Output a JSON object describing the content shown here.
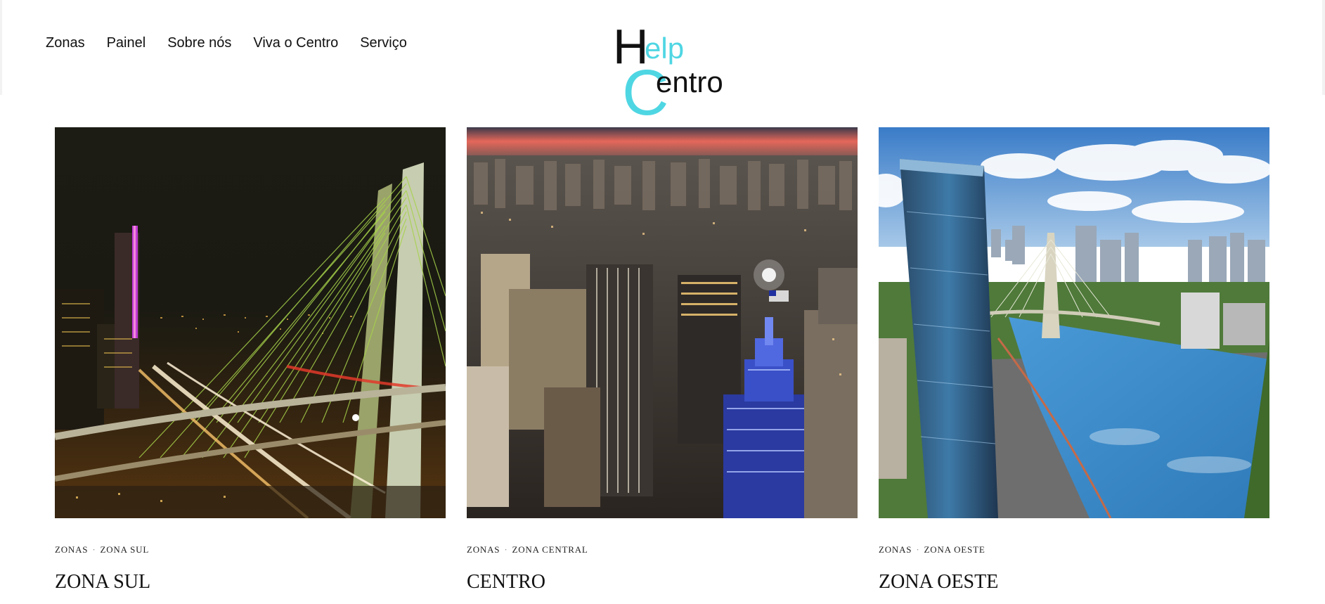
{
  "header": {
    "nav": [
      {
        "label": "Zonas"
      },
      {
        "label": "Painel"
      },
      {
        "label": "Sobre nós"
      },
      {
        "label": "Viva o Centro"
      },
      {
        "label": "Serviço"
      }
    ],
    "logo": {
      "big_h": "H",
      "small_elp": "elp",
      "big_c": "C",
      "small_entro": "entro",
      "colors": {
        "dark": "#111111",
        "accent": "#4fd6e3"
      }
    }
  },
  "cards": [
    {
      "category": "ZONAS",
      "subcategory": "ZONA SUL",
      "title": "ZONA SUL",
      "image": "night-cable-bridge-photo"
    },
    {
      "category": "ZONAS",
      "subcategory": "ZONA CENTRAL",
      "title": "CENTRO",
      "image": "downtown-aerial-sunset-photo"
    },
    {
      "category": "ZONAS",
      "subcategory": "ZONA OESTE",
      "title": "ZONA OESTE",
      "image": "riverside-aerial-day-photo"
    }
  ],
  "separator": "·"
}
